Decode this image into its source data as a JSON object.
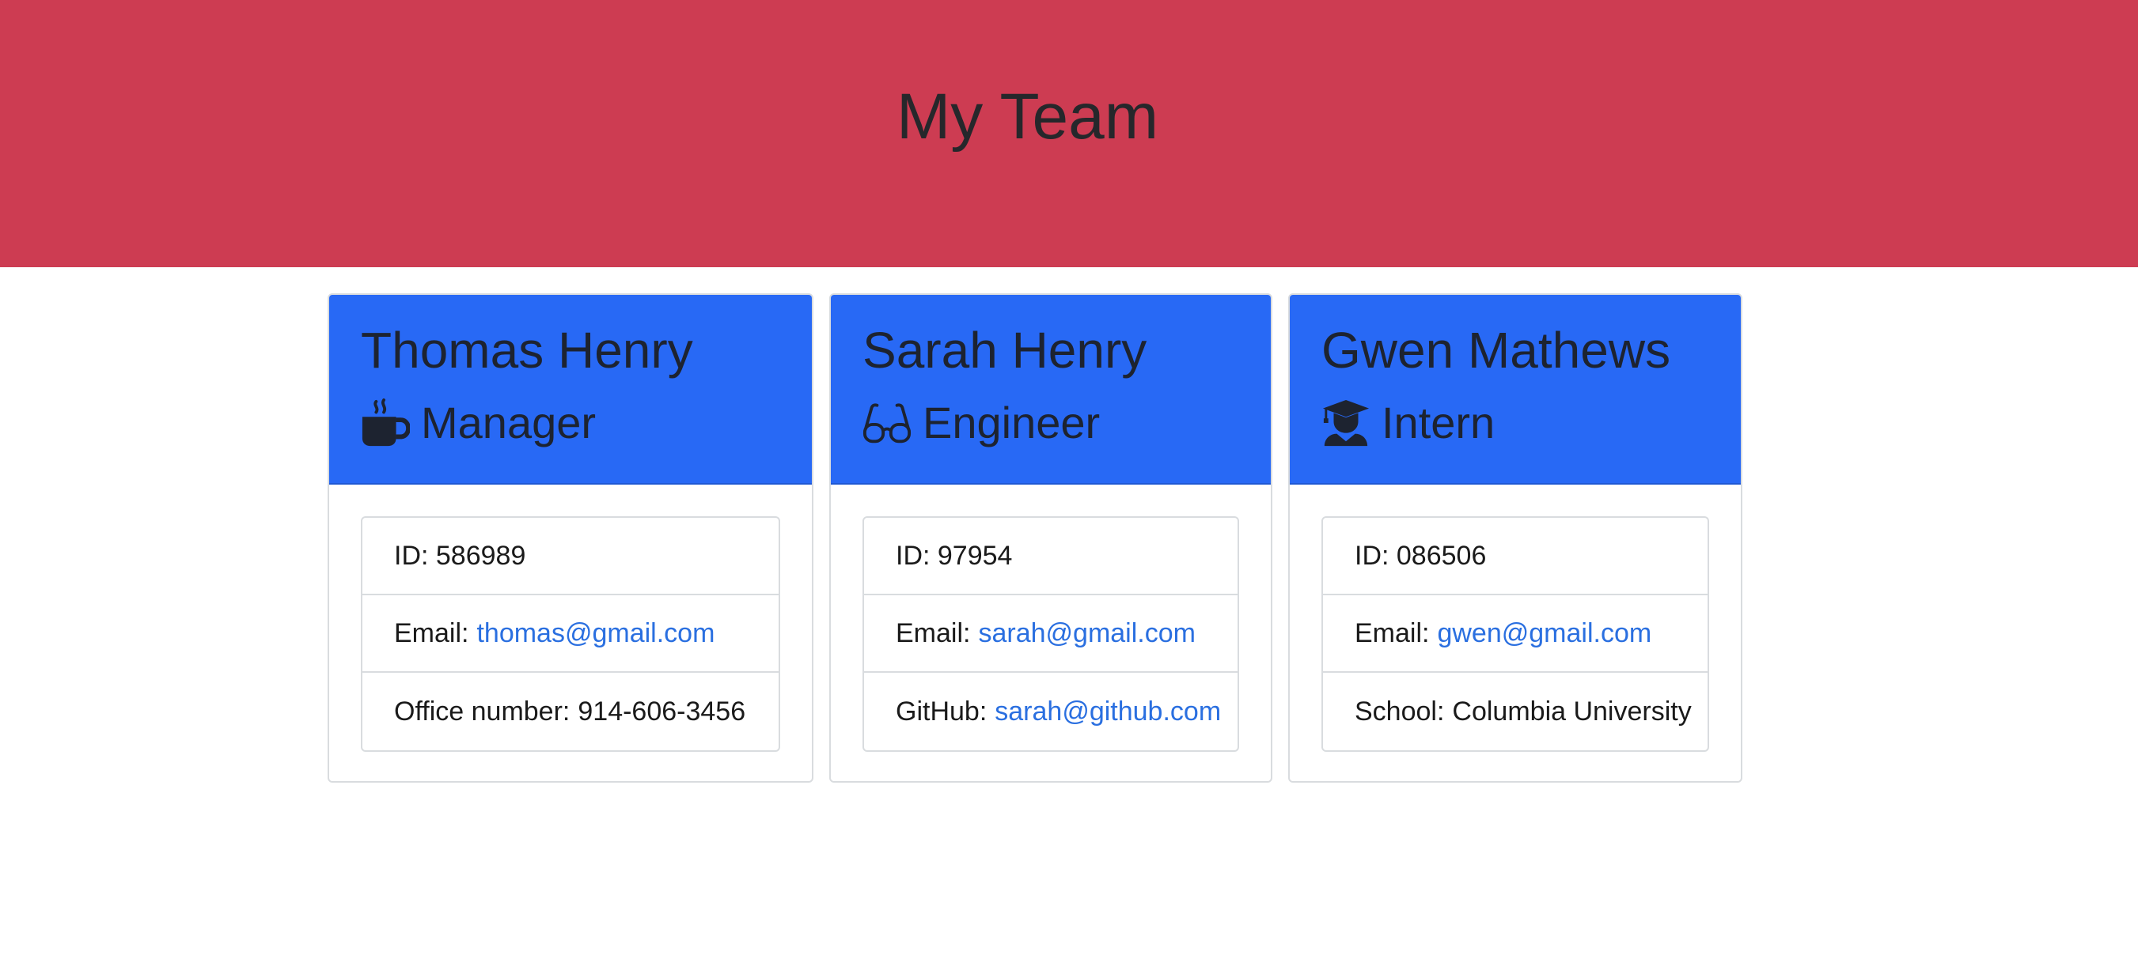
{
  "header": {
    "title": "My Team"
  },
  "team": [
    {
      "name": "Thomas Henry",
      "role": "Manager",
      "icon": "coffee-mug-icon",
      "id_label": "ID: 586989",
      "email_prefix": "Email:",
      "email": "thomas@gmail.com",
      "extra_prefix": "Office number:",
      "extra_value": "914-606-3456"
    },
    {
      "name": "Sarah Henry",
      "role": "Engineer",
      "icon": "glasses-icon",
      "id_label": "ID: 97954",
      "email_prefix": "Email:",
      "email": "sarah@gmail.com",
      "extra_prefix": "GitHub:",
      "extra_value": "sarah@github.com"
    },
    {
      "name": "Gwen Mathews",
      "role": "Intern",
      "icon": "graduate-icon",
      "id_label": "ID: 086506",
      "email_prefix": "Email:",
      "email": "gwen@gmail.com",
      "extra_prefix": "School:",
      "extra_value": "Columbia University"
    }
  ],
  "colors": {
    "header_bg": "#cd3c52",
    "card_header_bg": "#2869f5",
    "link": "#2a6fe0"
  }
}
